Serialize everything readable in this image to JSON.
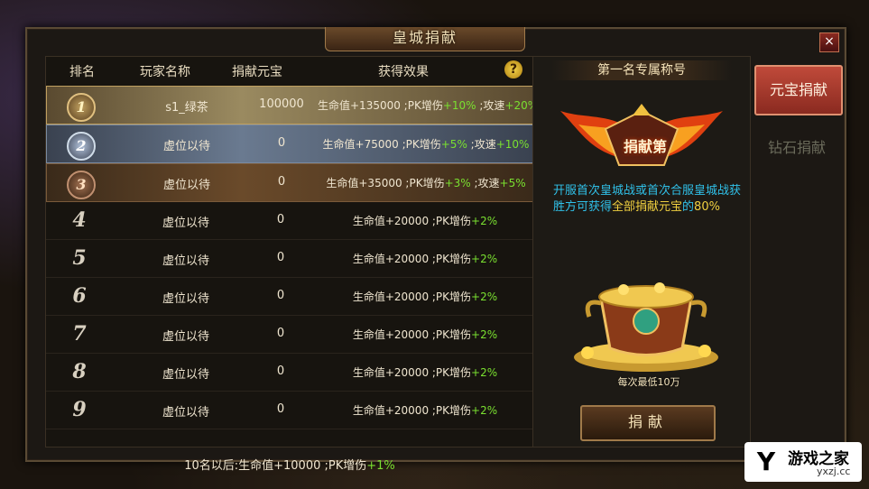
{
  "window": {
    "title": "皇城捐献",
    "close_label": "×"
  },
  "table": {
    "headers": {
      "rank": "排名",
      "player": "玩家名称",
      "amount": "捐献元宝",
      "effect": "获得效果"
    },
    "help_label": "?",
    "rows": [
      {
        "rank": "1",
        "player": "s1_绿茶",
        "amount": "100000",
        "effect_pre": "生命值+135000 ;PK增伤",
        "effect_hl1": "+10%",
        "effect_mid": " ;攻速",
        "effect_hl2": "+20%"
      },
      {
        "rank": "2",
        "player": "虚位以待",
        "amount": "0",
        "effect_pre": "生命值+75000 ;PK增伤",
        "effect_hl1": "+5%",
        "effect_mid": " ;攻速",
        "effect_hl2": "+10%"
      },
      {
        "rank": "3",
        "player": "虚位以待",
        "amount": "0",
        "effect_pre": "生命值+35000 ;PK增伤",
        "effect_hl1": "+3%",
        "effect_mid": " ;攻速",
        "effect_hl2": "+5%"
      },
      {
        "rank": "4",
        "player": "虚位以待",
        "amount": "0",
        "effect_pre": "生命值+20000 ;PK增伤",
        "effect_hl1": "+2%"
      },
      {
        "rank": "5",
        "player": "虚位以待",
        "amount": "0",
        "effect_pre": "生命值+20000 ;PK增伤",
        "effect_hl1": "+2%"
      },
      {
        "rank": "6",
        "player": "虚位以待",
        "amount": "0",
        "effect_pre": "生命值+20000 ;PK增伤",
        "effect_hl1": "+2%"
      },
      {
        "rank": "7",
        "player": "虚位以待",
        "amount": "0",
        "effect_pre": "生命值+20000 ;PK增伤",
        "effect_hl1": "+2%"
      },
      {
        "rank": "8",
        "player": "虚位以待",
        "amount": "0",
        "effect_pre": "生命值+20000 ;PK增伤",
        "effect_hl1": "+2%"
      },
      {
        "rank": "9",
        "player": "虚位以待",
        "amount": "0",
        "effect_pre": "生命值+20000 ;PK增伤",
        "effect_hl1": "+2%"
      }
    ],
    "footer_pre": "10名以后:生命值+10000 ;PK增伤",
    "footer_hl": "+1%"
  },
  "right_panel": {
    "title": "第一名专属称号",
    "badge_text": "捐献第",
    "desc_pre": "开服首次皇城战或首次合服皇城战获胜方可获得",
    "desc_hl1": "全部捐献元宝",
    "desc_mid": "的",
    "desc_hl2": "80%",
    "pot_label": "每次最低10万",
    "donate_button": "捐献"
  },
  "side_tabs": {
    "active": "元宝捐献",
    "inactive": "钻石捐献"
  },
  "watermark": {
    "logo": "Y",
    "name": "游戏之家",
    "domain": "yxzj.cc"
  },
  "colors": {
    "highlight_green": "#7ae030",
    "desc_cyan": "#30c0e8",
    "desc_yellow": "#f0d040",
    "active_tab": "#c04a3a"
  }
}
